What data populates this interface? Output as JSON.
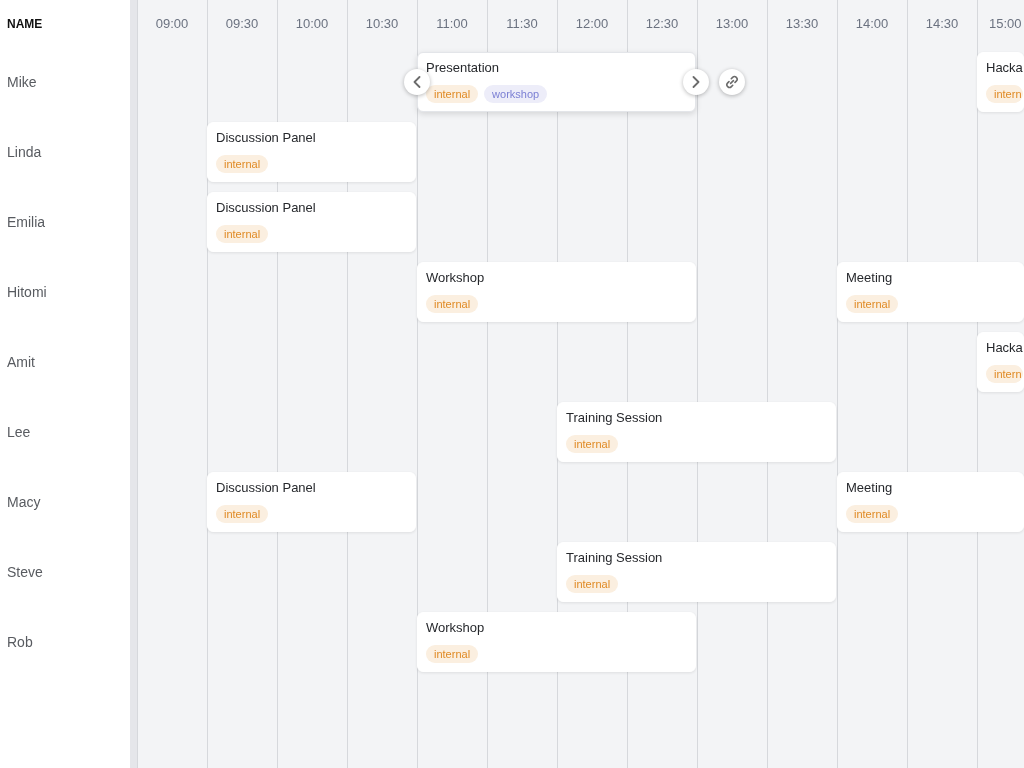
{
  "name_column": {
    "header": "NAME"
  },
  "timeline": {
    "slots": [
      "09:00",
      "09:30",
      "10:00",
      "10:30",
      "11:00",
      "11:30",
      "12:00",
      "12:30",
      "13:00",
      "13:30",
      "14:00",
      "14:30",
      "15:00"
    ]
  },
  "people": [
    {
      "name": "Mike",
      "slots": [
        {
          "kind": "empty"
        },
        {
          "kind": "empty"
        },
        {
          "kind": "empty"
        },
        {
          "kind": "empty"
        },
        {
          "kind": "event",
          "title": "Presentation",
          "selected": true,
          "tags": [
            {
              "label": "internal",
              "color": "#e08a24"
            },
            {
              "label": "workshop",
              "color": "#7c80d4"
            }
          ]
        },
        {
          "kind": "continued"
        },
        {
          "kind": "continued"
        },
        {
          "kind": "continued"
        },
        {
          "kind": "empty"
        },
        {
          "kind": "empty"
        },
        {
          "kind": "empty"
        },
        {
          "kind": "empty"
        },
        {
          "kind": "event",
          "title": "Hacka",
          "selected": false,
          "tags": [
            {
              "label": "intern",
              "color": "#e08a24"
            }
          ]
        }
      ]
    },
    {
      "name": "Linda",
      "slots": [
        {
          "kind": "empty"
        },
        {
          "kind": "event",
          "title": "Discussion Panel",
          "selected": false,
          "tags": [
            {
              "label": "internal",
              "color": "#e08a24"
            }
          ]
        },
        {
          "kind": "continued"
        },
        {
          "kind": "continued"
        },
        {
          "kind": "empty"
        },
        {
          "kind": "empty"
        },
        {
          "kind": "empty"
        },
        {
          "kind": "empty"
        },
        {
          "kind": "empty"
        },
        {
          "kind": "empty"
        },
        {
          "kind": "empty"
        },
        {
          "kind": "empty"
        },
        {
          "kind": "empty"
        }
      ]
    },
    {
      "name": "Emilia",
      "slots": [
        {
          "kind": "empty"
        },
        {
          "kind": "event",
          "title": "Discussion Panel",
          "selected": false,
          "tags": [
            {
              "label": "internal",
              "color": "#e08a24"
            }
          ]
        },
        {
          "kind": "continued"
        },
        {
          "kind": "continued"
        },
        {
          "kind": "empty"
        },
        {
          "kind": "empty"
        },
        {
          "kind": "empty"
        },
        {
          "kind": "empty"
        },
        {
          "kind": "empty"
        },
        {
          "kind": "empty"
        },
        {
          "kind": "empty"
        },
        {
          "kind": "empty"
        },
        {
          "kind": "empty"
        }
      ]
    },
    {
      "name": "Hitomi",
      "slots": [
        {
          "kind": "empty"
        },
        {
          "kind": "empty"
        },
        {
          "kind": "empty"
        },
        {
          "kind": "empty"
        },
        {
          "kind": "event",
          "title": "Workshop",
          "selected": false,
          "tags": [
            {
              "label": "internal",
              "color": "#e08a24"
            }
          ]
        },
        {
          "kind": "continued"
        },
        {
          "kind": "continued"
        },
        {
          "kind": "continued"
        },
        {
          "kind": "empty"
        },
        {
          "kind": "empty"
        },
        {
          "kind": "event",
          "title": "Meeting",
          "selected": false,
          "tags": [
            {
              "label": "internal",
              "color": "#e08a24"
            }
          ]
        },
        {
          "kind": "continued"
        },
        {
          "kind": "continued"
        }
      ]
    },
    {
      "name": "Amit",
      "slots": [
        {
          "kind": "empty"
        },
        {
          "kind": "empty"
        },
        {
          "kind": "empty"
        },
        {
          "kind": "empty"
        },
        {
          "kind": "empty"
        },
        {
          "kind": "empty"
        },
        {
          "kind": "empty"
        },
        {
          "kind": "empty"
        },
        {
          "kind": "empty"
        },
        {
          "kind": "empty"
        },
        {
          "kind": "empty"
        },
        {
          "kind": "empty"
        },
        {
          "kind": "event",
          "title": "Hacka",
          "selected": false,
          "tags": [
            {
              "label": "intern",
              "color": "#e08a24"
            }
          ]
        }
      ]
    },
    {
      "name": "Lee",
      "slots": [
        {
          "kind": "empty"
        },
        {
          "kind": "empty"
        },
        {
          "kind": "empty"
        },
        {
          "kind": "empty"
        },
        {
          "kind": "empty"
        },
        {
          "kind": "empty"
        },
        {
          "kind": "event",
          "title": "Training Session",
          "selected": false,
          "tags": [
            {
              "label": "internal",
              "color": "#e08a24"
            }
          ]
        },
        {
          "kind": "continued"
        },
        {
          "kind": "continued"
        },
        {
          "kind": "continued"
        },
        {
          "kind": "empty"
        },
        {
          "kind": "empty"
        },
        {
          "kind": "empty"
        }
      ]
    },
    {
      "name": "Macy",
      "slots": [
        {
          "kind": "empty"
        },
        {
          "kind": "event",
          "title": "Discussion Panel",
          "selected": false,
          "tags": [
            {
              "label": "internal",
              "color": "#e08a24"
            }
          ]
        },
        {
          "kind": "continued"
        },
        {
          "kind": "continued"
        },
        {
          "kind": "empty"
        },
        {
          "kind": "empty"
        },
        {
          "kind": "empty"
        },
        {
          "kind": "empty"
        },
        {
          "kind": "empty"
        },
        {
          "kind": "empty"
        },
        {
          "kind": "event",
          "title": "Meeting",
          "selected": false,
          "tags": [
            {
              "label": "internal",
              "color": "#e08a24"
            }
          ]
        },
        {
          "kind": "continued"
        },
        {
          "kind": "continued"
        }
      ]
    },
    {
      "name": "Steve",
      "slots": [
        {
          "kind": "empty"
        },
        {
          "kind": "empty"
        },
        {
          "kind": "empty"
        },
        {
          "kind": "empty"
        },
        {
          "kind": "empty"
        },
        {
          "kind": "empty"
        },
        {
          "kind": "event",
          "title": "Training Session",
          "selected": false,
          "tags": [
            {
              "label": "internal",
              "color": "#e08a24"
            }
          ]
        },
        {
          "kind": "continued"
        },
        {
          "kind": "continued"
        },
        {
          "kind": "continued"
        },
        {
          "kind": "empty"
        },
        {
          "kind": "empty"
        },
        {
          "kind": "empty"
        }
      ]
    },
    {
      "name": "Rob",
      "slots": [
        {
          "kind": "empty"
        },
        {
          "kind": "empty"
        },
        {
          "kind": "empty"
        },
        {
          "kind": "empty"
        },
        {
          "kind": "event",
          "title": "Workshop",
          "selected": false,
          "tags": [
            {
              "label": "internal",
              "color": "#e08a24"
            }
          ]
        },
        {
          "kind": "continued"
        },
        {
          "kind": "continued"
        },
        {
          "kind": "continued"
        },
        {
          "kind": "empty"
        },
        {
          "kind": "empty"
        },
        {
          "kind": "empty"
        },
        {
          "kind": "empty"
        },
        {
          "kind": "empty"
        }
      ]
    }
  ]
}
